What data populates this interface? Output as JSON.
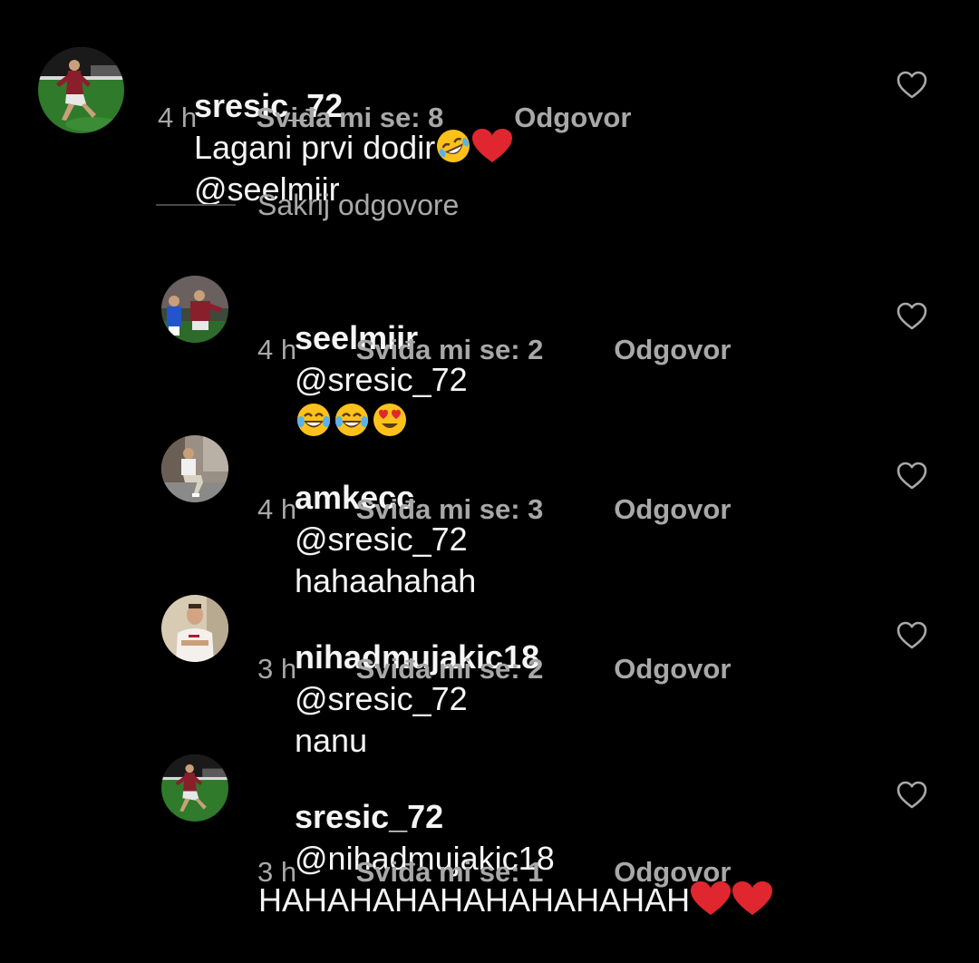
{
  "colors": {
    "background": "#000000",
    "text": "#f5f5f5",
    "muted": "#a8a8a8",
    "heart": "#e0262e"
  },
  "comments": [
    {
      "username": "sresic_72",
      "text": "Lagani prvi dodir",
      "emojis": [
        "rolling-on-floor-laughing",
        "red-heart"
      ],
      "mention": "@seelmiir",
      "time": "4 h",
      "likes": "Sviđa mi se: 8",
      "reply": "Odgovor",
      "avatar": "football-player-green-pitch",
      "like_icon": "heart-outline-icon"
    }
  ],
  "toggle": {
    "label": "Sakrij odgovore"
  },
  "replies": [
    {
      "username": "seelmiir",
      "mention": "@sresic_72",
      "text": "",
      "emojis": [
        "tears-of-joy",
        "tears-of-joy",
        "heart-eyes"
      ],
      "time": "4 h",
      "likes": "Sviđa mi se: 2",
      "reply": "Odgovor",
      "avatar": "football-players-match"
    },
    {
      "username": "amkecc",
      "mention": "@sresic_72",
      "text": "hahaahahah",
      "emojis": [],
      "time": "4 h",
      "likes": "Sviđa mi se: 3",
      "reply": "Odgovor",
      "avatar": "man-sitting"
    },
    {
      "username": "nihadmujakic18",
      "mention": "@sresic_72",
      "text": "nanu",
      "emojis": [],
      "time": "3 h",
      "likes": "Sviđa mi se: 2",
      "reply": "Odgovor",
      "avatar": "man-portrait"
    },
    {
      "username": "sresic_72",
      "mention": "@nihadmujakic18",
      "text": "HAHAHAHAHAHAHAHAHAH",
      "emojis": [
        "red-heart",
        "red-heart"
      ],
      "time": "3 h",
      "likes": "Sviđa mi se: 1",
      "reply": "Odgovor",
      "avatar": "football-player-green-pitch"
    }
  ]
}
